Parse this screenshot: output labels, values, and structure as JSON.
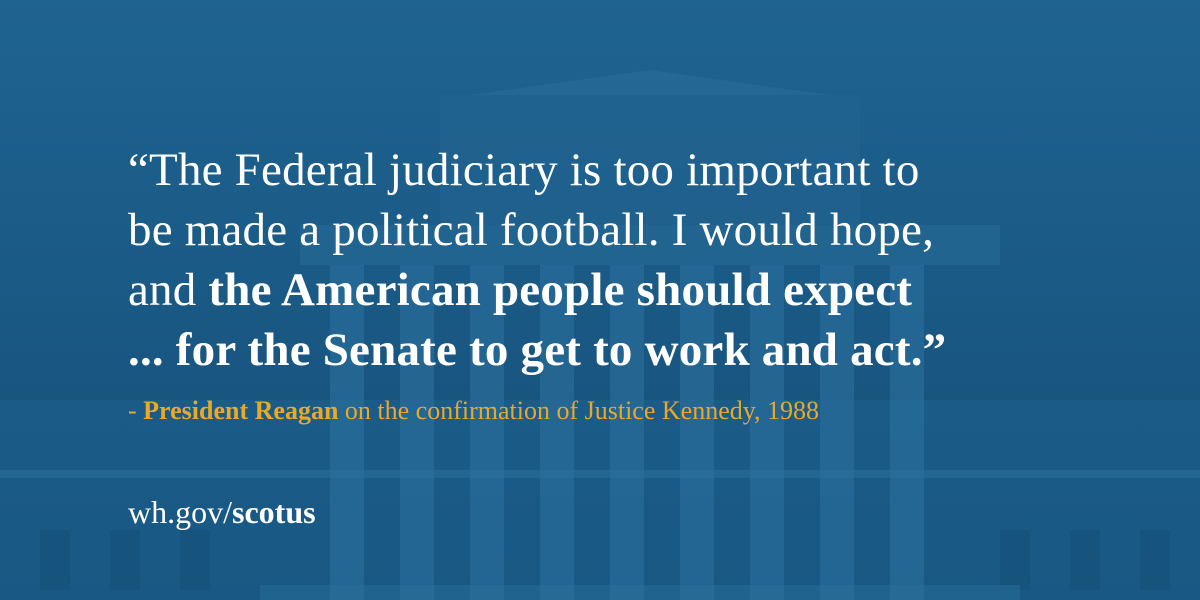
{
  "quote": {
    "line1": "“The Federal judiciary is too important to",
    "line2": "be made a political football. I would hope,",
    "line3_regular": "and ",
    "line3_bold": "the American people should expect",
    "line4_bold": "... for the Senate to get to work and act.”"
  },
  "attribution": {
    "dash": "- ",
    "name": "President Reagan",
    "rest": " on the confirmation of Justice Kennedy, 1988"
  },
  "url": {
    "prefix": "wh.gov/",
    "bold": "scotus"
  },
  "colors": {
    "background": "#1b5b86",
    "text": "#ffffff",
    "accent": "#e8a92b"
  },
  "icons": {
    "background_image": "supreme-court-building-icon"
  }
}
